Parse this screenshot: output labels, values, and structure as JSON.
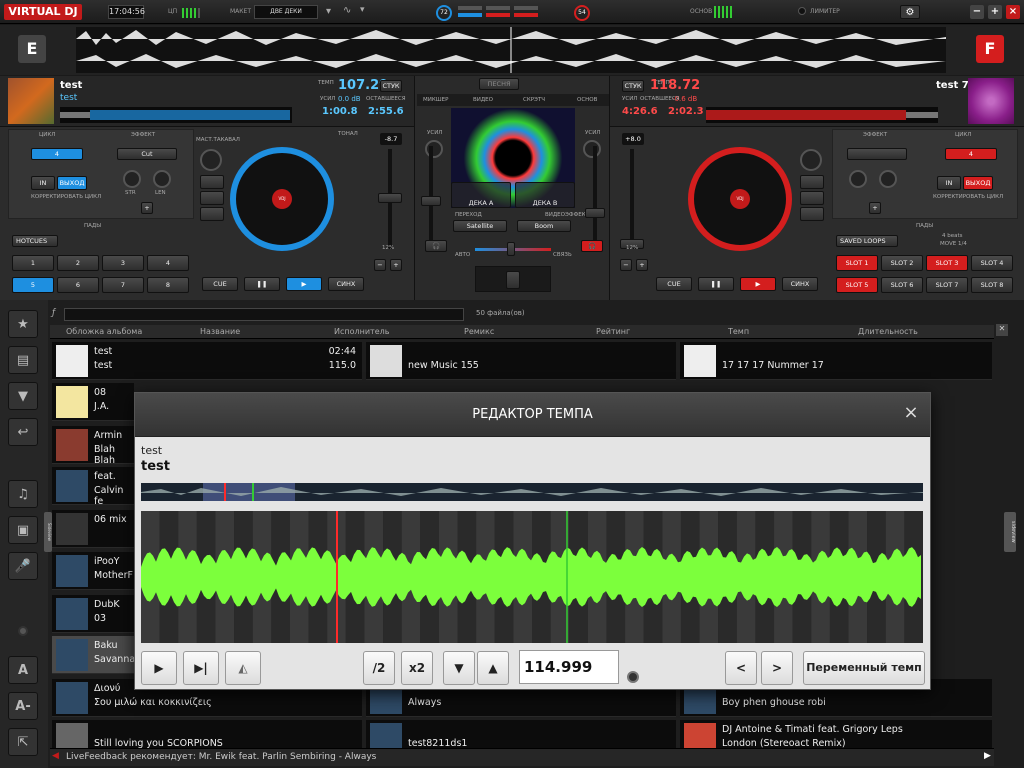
{
  "app": {
    "logo": "VIRTUAL DJ"
  },
  "topbar": {
    "clock": "17:04:56",
    "cpu_label": "ЦП",
    "layout_label": "МАКЕТ",
    "layout_value": "ДВЕ ДЕКИ",
    "left_knob": "72",
    "right_knob": "54",
    "master_label": "ОСНОВ",
    "limiter_label": "ЛИМИТЕР",
    "gear": "⚙",
    "win_min": "−",
    "win_max": "+",
    "win_close": "×"
  },
  "decks": {
    "left": {
      "letter": "E",
      "title": "test",
      "artist": "test",
      "bpm_label": "ТЕМП",
      "bpm": "107.29",
      "key_btn": "СТУК",
      "gain_label": "УСИЛ",
      "gain": "0.0 dB",
      "remain_label": "ОСТАВШЕЕСЯ",
      "remain": "2:55.6",
      "elapsed": "1:00.8",
      "loop_label": "ЦИКЛ",
      "loop_value": "4",
      "effect_label": "ЭФФЕКТ",
      "effect_value": "Cut",
      "in_btn": "IN",
      "out_btn": "ВЫХОД",
      "str_label": "STR",
      "len_label": "LEN",
      "loop_tools_label": "КОРРЕКТИРОВАТЬ ЦИКЛ",
      "pads_label": "ПАДЫ",
      "pad_mode": "HOTCUES",
      "pads": [
        "1",
        "2",
        "3",
        "4",
        "5",
        "6",
        "7",
        "8"
      ],
      "pitch_value": "-8.7",
      "pitch_range": "12%",
      "master_tempo_label": "МАСТ.ТАКАВАЛ",
      "key_label": "ТОНАЛ",
      "cue": "CUE",
      "play_pause": "❚❚",
      "play": "▶",
      "sync": "СИНХ",
      "minus": "−",
      "plus": "+"
    },
    "right": {
      "letter": "F",
      "title": "test 7",
      "bpm_label": "ТЕМП",
      "bpm": "118.72",
      "key_btn": "СТУК",
      "gain_label": "УСИЛ",
      "gain": "-0.6 dB",
      "remain_label": "ОСТАВШЕЕСЯ",
      "remain": "2:02.3",
      "elapsed": "4:26.6",
      "loop_label": "ЦИКЛ",
      "loop_value": "4",
      "effect_label": "ЭФФЕКТ",
      "in_btn": "IN",
      "out_btn": "ВЫХОД",
      "loop_tools_label": "КОРРЕКТИРОВАТЬ ЦИКЛ",
      "pads_label": "ПАДЫ",
      "pad_mode": "SAVED LOOPS",
      "pad_hint_1": "4 beats",
      "pad_hint_2": "MOVE 1/4",
      "pads": [
        "SLOT 1",
        "SLOT 2",
        "SLOT 3",
        "SLOT 4",
        "SLOT 5",
        "SLOT 6",
        "SLOT 7",
        "SLOT 8"
      ],
      "pitch_value": "+8.0",
      "pitch_range": "12%",
      "cue": "CUE",
      "play_pause": "❚❚",
      "play": "▶",
      "sync": "СИНХ",
      "minus": "−",
      "plus": "+"
    }
  },
  "mixer": {
    "tab_mixer": "МИКШЕР",
    "tab_video": "ВИДЕО",
    "tab_scratch": "СКРЭТЧ",
    "tab_master": "ОСНОВ",
    "gain_left": "УСИЛ",
    "gain_right": "УСИЛ",
    "preview_btn": "ПЕСНЯ",
    "deck_a": "ДЕКА A",
    "deck_b": "ДЕКА B",
    "transition_label": "ПЕРЕХОД",
    "transition_value": "Satellite",
    "fx_label": "ВИДЕОЭФФЕКТ",
    "fx_value": "Boom",
    "auto_label": "АВТО",
    "link_label": "СВЯЗЬ"
  },
  "browser": {
    "search_placeholder": "",
    "file_count": "50 файла(ов)",
    "columns": [
      "Обложка альбома",
      "Название",
      "Исполнитель",
      "Ремикс",
      "Рейтинг",
      "Темп",
      "Длительность"
    ],
    "col1": [
      {
        "title": "test",
        "artist": "test",
        "time": "02:44",
        "bpm": "115.0"
      },
      {
        "title": "08",
        "artist": "J.A."
      },
      {
        "title": "Armin",
        "artist": "Blah Blah"
      },
      {
        "title": "feat.",
        "artist": "Calvin fe"
      },
      {
        "title": "06 mix",
        "artist": ""
      },
      {
        "title": "iPooY",
        "artist": "MotherF"
      },
      {
        "title": "DubK",
        "artist": "03"
      },
      {
        "title": "Baku",
        "artist": "Savanna"
      },
      {
        "title": "Διονύ",
        "artist": "Σου μιλώ και κοκκινίζεις"
      },
      {
        "title": "Still loving you SCORPIONS",
        "artist": ""
      }
    ],
    "col2": [
      {
        "title": "new Music 155",
        "artist": ""
      },
      {
        "title": "Always",
        "artist": ""
      },
      {
        "title": "test8211ds1",
        "artist": ""
      }
    ],
    "col3": [
      {
        "title": "17 17 17 Nummer 17",
        "artist": ""
      },
      {
        "title": "Boy phen ghouse robi",
        "artist": ""
      },
      {
        "title": "DJ Antoine & Timati feat. Grigory Leps",
        "artist": "London (Stereoact Remix)"
      }
    ],
    "live_feedback": "LiveFeedback рекомендует: Mr. Ewik feat. Parlin Sembiring - Always",
    "side_label_left": "Sideview",
    "side_label_right": "sideview"
  },
  "modal": {
    "title": "РЕДАКТОР ТЕМПА",
    "close": "×",
    "track_artist": "test",
    "track_title": "test",
    "half": "/2",
    "double": "x2",
    "down": "▼",
    "up": "▲",
    "bpm_value": "114.999",
    "prev": "<",
    "next": ">",
    "variable": "Переменный темп"
  },
  "colors": {
    "accent_blue": "#1e8fe0",
    "accent_red": "#d41e1e",
    "wave_green": "#7cff3c"
  }
}
